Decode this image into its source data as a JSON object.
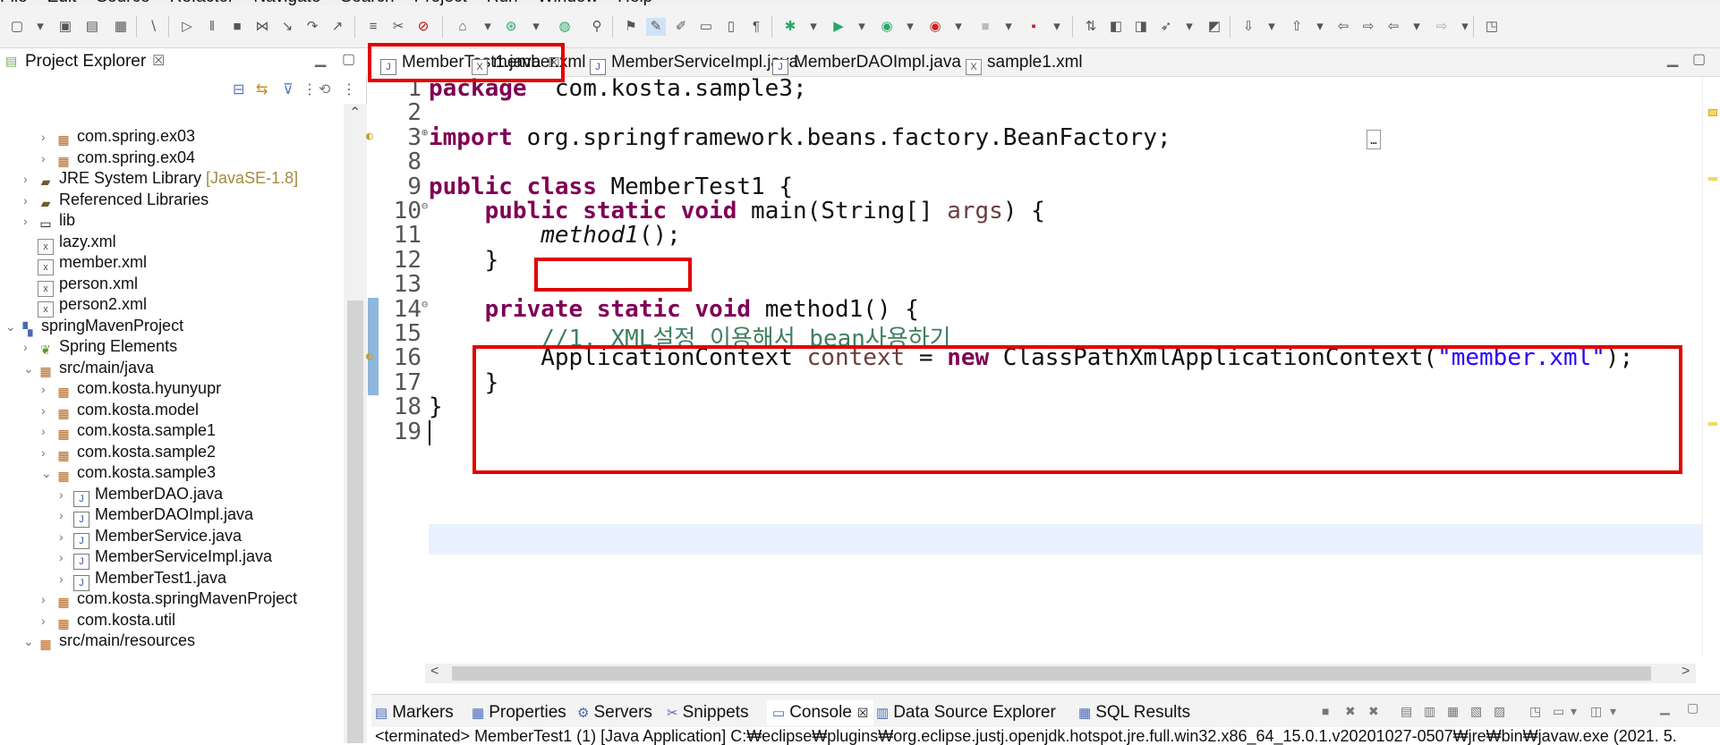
{
  "menu": [
    "File",
    "Edit",
    "Source",
    "Refactor",
    "Navigate",
    "Search",
    "Project",
    "Run",
    "Window",
    "Help"
  ],
  "project_explorer": {
    "title": "Project Explorer",
    "close": "☒",
    "tree": [
      {
        "label": "com.spring.ex03",
        "depth": 3,
        "type": "package",
        "twisty": ">"
      },
      {
        "label": "com.spring.ex04",
        "depth": 3,
        "type": "package",
        "twisty": ">"
      },
      {
        "label": "JRE System Library",
        "suffix": "[JavaSE-1.8]",
        "depth": 2,
        "type": "library",
        "twisty": ">"
      },
      {
        "label": "Referenced Libraries",
        "depth": 2,
        "type": "library",
        "twisty": ">"
      },
      {
        "label": "lib",
        "depth": 2,
        "type": "folder",
        "twisty": ">"
      },
      {
        "label": "lazy.xml",
        "depth": 2,
        "type": "xml",
        "twisty": ""
      },
      {
        "label": "member.xml",
        "depth": 2,
        "type": "xml",
        "twisty": ""
      },
      {
        "label": "person.xml",
        "depth": 2,
        "type": "xml",
        "twisty": ""
      },
      {
        "label": "person2.xml",
        "depth": 2,
        "type": "xml",
        "twisty": ""
      },
      {
        "label": "springMavenProject",
        "depth": 1,
        "type": "project",
        "twisty": "v"
      },
      {
        "label": "Spring Elements",
        "depth": 2,
        "type": "spring",
        "twisty": ">"
      },
      {
        "label": "src/main/java",
        "depth": 2,
        "type": "srcfolder",
        "twisty": "v"
      },
      {
        "label": "com.kosta.hyunyupr",
        "depth": 3,
        "type": "package",
        "twisty": ">"
      },
      {
        "label": "com.kosta.model",
        "depth": 3,
        "type": "package",
        "twisty": ">"
      },
      {
        "label": "com.kosta.sample1",
        "depth": 3,
        "type": "package",
        "twisty": ">"
      },
      {
        "label": "com.kosta.sample2",
        "depth": 3,
        "type": "package",
        "twisty": ">"
      },
      {
        "label": "com.kosta.sample3",
        "depth": 3,
        "type": "package",
        "twisty": "v"
      },
      {
        "label": "MemberDAO.java",
        "depth": 4,
        "type": "java",
        "twisty": ">"
      },
      {
        "label": "MemberDAOImpl.java",
        "depth": 4,
        "type": "java",
        "twisty": ">"
      },
      {
        "label": "MemberService.java",
        "depth": 4,
        "type": "java",
        "twisty": ">"
      },
      {
        "label": "MemberServiceImpl.java",
        "depth": 4,
        "type": "java",
        "twisty": ">"
      },
      {
        "label": "MemberTest1.java",
        "depth": 4,
        "type": "java",
        "twisty": ">"
      },
      {
        "label": "com.kosta.springMavenProject",
        "depth": 3,
        "type": "package",
        "twisty": ">"
      },
      {
        "label": "com.kosta.util",
        "depth": 3,
        "type": "package",
        "twisty": ">"
      },
      {
        "label": "src/main/resources",
        "depth": 2,
        "type": "srcfolder",
        "twisty": "v"
      }
    ]
  },
  "editor_tabs": [
    {
      "label": "MemberTest1.java",
      "icon": "J",
      "active": true,
      "close": "☒"
    },
    {
      "label": "member.xml",
      "icon": "X",
      "active": false
    },
    {
      "label": "MemberServiceImpl.java",
      "icon": "J",
      "active": false
    },
    {
      "label": "MemberDAOImpl.java",
      "icon": "J",
      "active": false
    },
    {
      "label": "sample1.xml",
      "icon": "X",
      "active": false
    }
  ],
  "code": {
    "lines": [
      {
        "no": "1",
        "marker": "",
        "html_key": "l1"
      },
      {
        "no": "2",
        "marker": "",
        "html_key": "l2"
      },
      {
        "no": "3",
        "marker": "⊕",
        "html_key": "l3"
      },
      {
        "no": "8",
        "marker": "",
        "html_key": "l8"
      },
      {
        "no": "9",
        "marker": "",
        "html_key": "l9"
      },
      {
        "no": "10",
        "marker": "⊖",
        "html_key": "l10"
      },
      {
        "no": "11",
        "marker": "",
        "html_key": "l11"
      },
      {
        "no": "12",
        "marker": "",
        "html_key": "l12"
      },
      {
        "no": "13",
        "marker": "",
        "html_key": "l13"
      },
      {
        "no": "14",
        "marker": "⊖",
        "html_key": "l14"
      },
      {
        "no": "15",
        "marker": "",
        "html_key": "l15"
      },
      {
        "no": "16",
        "marker": "",
        "html_key": "l16"
      },
      {
        "no": "17",
        "marker": "",
        "html_key": "l17"
      },
      {
        "no": "18",
        "marker": "",
        "html_key": "l18"
      },
      {
        "no": "19",
        "marker": "",
        "html_key": "l19"
      }
    ],
    "tokens": {
      "l1": [
        [
          "kw",
          "package"
        ],
        [
          "",
          "  com.kosta.sample3;"
        ]
      ],
      "l2": [],
      "l3": [
        [
          "kw",
          "import"
        ],
        [
          "",
          " org.springframework.beans.factory.BeanFactory;"
        ]
      ],
      "l8": [],
      "l9": [
        [
          "kw",
          "public"
        ],
        [
          "",
          " "
        ],
        [
          "kw",
          "class"
        ],
        [
          "",
          " MemberTest1 {"
        ]
      ],
      "l10": [
        [
          "",
          "    "
        ],
        [
          "kw",
          "public"
        ],
        [
          "",
          " "
        ],
        [
          "kw",
          "static"
        ],
        [
          "",
          " "
        ],
        [
          "kw",
          "void"
        ],
        [
          "",
          " main(String[] "
        ],
        [
          "pa",
          "args"
        ],
        [
          "",
          ") {"
        ]
      ],
      "l11": [
        [
          "",
          "        "
        ],
        [
          "it",
          "method1"
        ],
        [
          "",
          "();"
        ]
      ],
      "l12": [
        [
          "",
          "    }"
        ]
      ],
      "l13": [],
      "l14": [
        [
          "",
          "    "
        ],
        [
          "kw",
          "private"
        ],
        [
          "",
          " "
        ],
        [
          "kw",
          "static"
        ],
        [
          "",
          " "
        ],
        [
          "kw",
          "void"
        ],
        [
          "",
          " method1() {"
        ]
      ],
      "l15": [
        [
          "",
          "        "
        ],
        [
          "cm",
          "//1. XML설정 이용해서 bean사용하기"
        ]
      ],
      "l16": [
        [
          "",
          "        ApplicationContext "
        ],
        [
          "pa",
          "context"
        ],
        [
          "",
          " = "
        ],
        [
          "kw",
          "new"
        ],
        [
          "",
          " ClassPathXmlApplicationContext("
        ],
        [
          "st",
          "\"member.xml\""
        ],
        [
          "",
          ");"
        ]
      ],
      "l17": [
        [
          "",
          "    }"
        ]
      ],
      "l18": [
        [
          "",
          "}"
        ]
      ],
      "l19": []
    }
  },
  "bottom_tabs": [
    {
      "label": "Markers",
      "icon": "marker-icon"
    },
    {
      "label": "Properties",
      "icon": "properties-icon"
    },
    {
      "label": "Servers",
      "icon": "servers-icon"
    },
    {
      "label": "Snippets",
      "icon": "snippets-icon"
    },
    {
      "label": "Console",
      "icon": "console-icon",
      "active": true,
      "close": "☒"
    },
    {
      "label": "Data Source Explorer",
      "icon": "datasource-icon"
    },
    {
      "label": "SQL Results",
      "icon": "sql-icon"
    }
  ],
  "console": {
    "status": "<terminated> MemberTest1 (1) [Java Application] C:₩eclipse₩plugins₩org.eclipse.justj.openjdk.hotspot.jre.full.win32.x86_64_15.0.1.v20201027-0507₩jre₩bin₩javaw.exe  (2021. 5."
  },
  "colors": {
    "highlight_box": "#e00000",
    "keyword": "#7f0055",
    "comment": "#3f7f5f",
    "string": "#2a00ff"
  }
}
